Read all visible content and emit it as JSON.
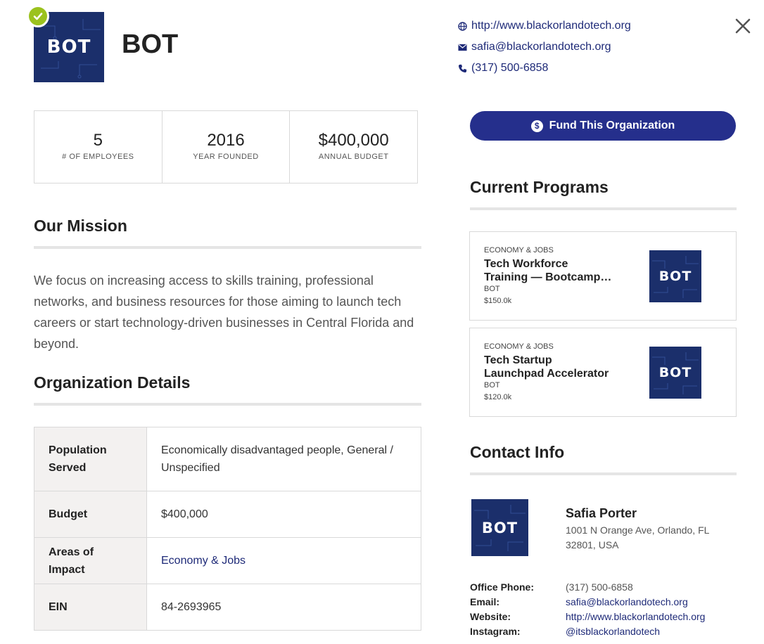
{
  "org": {
    "name": "BOT",
    "logo_text": "BOT"
  },
  "top_links": {
    "website": "http://www.blackorlandotech.org",
    "email": "safia@blackorlandotech.org",
    "phone": "(317) 500-6858"
  },
  "close_label": "✕",
  "stats": [
    {
      "value": "5",
      "label": "# OF EMPLOYEES"
    },
    {
      "value": "2016",
      "label": "YEAR FOUNDED"
    },
    {
      "value": "$400,000",
      "label": "ANNUAL BUDGET"
    }
  ],
  "mission": {
    "heading": "Our Mission",
    "text": "We focus on increasing access to skills training, professional networks, and business resources for those aiming to launch tech careers or start technology-driven businesses in Central Florida and beyond."
  },
  "details": {
    "heading": "Organization Details",
    "rows": [
      {
        "key": "Population Served",
        "value": "Economically disadvantaged people, General / Unspecified"
      },
      {
        "key": "Budget",
        "value": "$400,000"
      },
      {
        "key": "Areas of Impact",
        "value": "Economy & Jobs"
      },
      {
        "key": "EIN",
        "value": "84-2693965"
      }
    ]
  },
  "fund_button": {
    "icon": "$",
    "label": "Fund This Organization"
  },
  "programs": {
    "heading": "Current Programs",
    "items": [
      {
        "category": "ECONOMY & JOBS",
        "title": "Tech Workforce Training — Bootcamp…",
        "org": "BOT",
        "amount": "$150.0k"
      },
      {
        "category": "ECONOMY & JOBS",
        "title": "Tech Startup Launchpad Accelerator",
        "org": "BOT",
        "amount": "$120.0k"
      }
    ]
  },
  "contact": {
    "heading": "Contact Info",
    "name": "Safia Porter",
    "address": "1001 N Orange Ave, Orlando, FL 32801, USA",
    "rows": [
      {
        "key": "Office Phone:",
        "value": "(317) 500-6858"
      },
      {
        "key": "Email:",
        "value": "safia@blackorlandotech.org"
      },
      {
        "key": "Website:",
        "value": "http://www.blackorlandotech.org"
      },
      {
        "key": "Instagram:",
        "value": "@itsblackorlandotech"
      }
    ]
  },
  "colors": {
    "brand_navy": "#1b2f6b",
    "button": "#252f8c",
    "link": "#1e2a78",
    "verified": "#9bc21e"
  }
}
